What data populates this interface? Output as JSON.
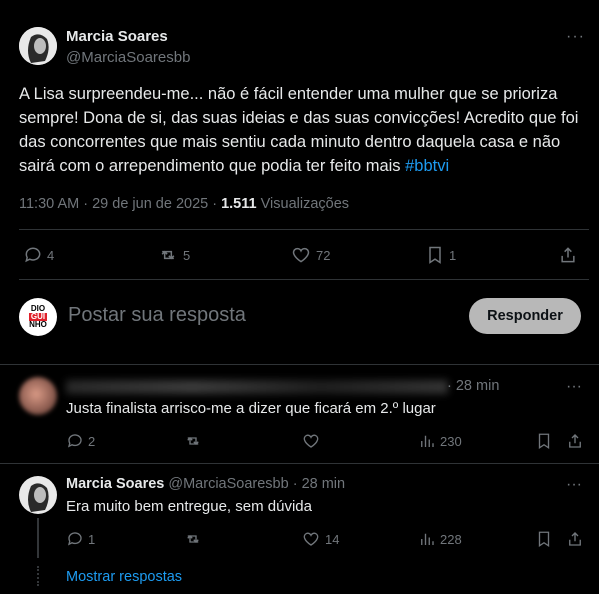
{
  "main_post": {
    "author_name": "Marcia Soares",
    "author_handle": "@MarciaSoaresbb",
    "text_main": "A Lisa surpreendeu-me... não é fácil entender uma mulher que se prioriza sempre! Dona de si, das suas ideias e das suas convicções! Acredito que foi das  concorrentes que mais sentiu cada minuto dentro daquela casa e não sairá com o arrependimento que podia ter feito mais ",
    "hashtag": "#bbtvi",
    "time": "11:30 AM",
    "date": "29 de jun de 2025",
    "views_count": "1.511",
    "views_label": "Visualizações",
    "replies": "4",
    "reposts": "5",
    "likes": "72",
    "bookmarks": "1"
  },
  "reply_box": {
    "avatar_text_1": "DIO",
    "avatar_text_2": "GUI",
    "avatar_text_3": "NHO",
    "placeholder": "Postar sua resposta",
    "button_label": "Responder"
  },
  "reply1": {
    "time": "· 28 min",
    "text": "Justa finalista arrisco-me a dizer que ficará em 2.º lugar",
    "replies": "2",
    "views": "230"
  },
  "reply2": {
    "author_name": "Marcia Soares",
    "author_handle": "@MarciaSoaresbb",
    "time": "· 28 min",
    "text": "Era muito bem entregue, sem dúvida",
    "replies": "1",
    "likes": "14",
    "views": "228"
  },
  "show_replies": "Mostrar respostas",
  "more_symbol": "···",
  "colors": {
    "accent": "#1d9bf0",
    "muted": "#71767b",
    "button_bg": "#d9d9d9"
  }
}
